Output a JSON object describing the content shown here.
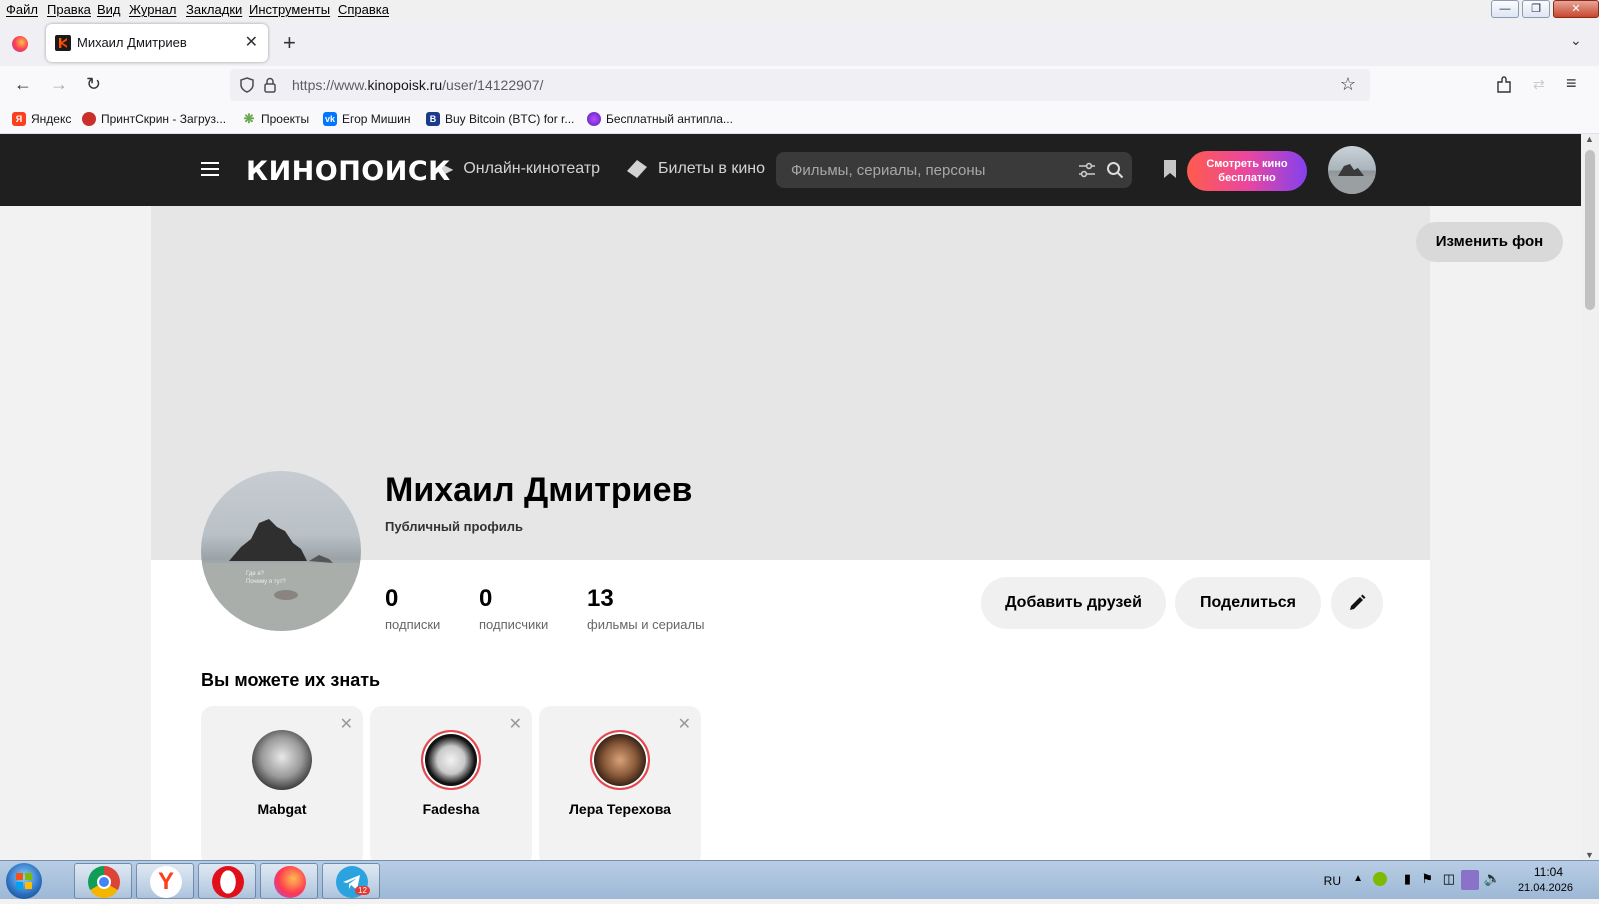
{
  "menubar": [
    "Файл",
    "Правка",
    "Вид",
    "Журнал",
    "Закладки",
    "Инструменты",
    "Справка"
  ],
  "tab": {
    "title": "Михаил Дмитриев"
  },
  "address": {
    "prefix": "https://www.",
    "domain": "kinopoisk.ru",
    "path": "/user/14122907/"
  },
  "bookmarks": [
    "Яндекс",
    "ПринтСкрин - Загруз...",
    "Проекты",
    "Егор Мишин",
    "Buy Bitcoin (BTC) for r...",
    "Бесплатный антипла..."
  ],
  "site": {
    "logo": "КИНОПОИСК",
    "nav_online": "Онлайн-кинотеатр",
    "nav_tickets": "Билеты в кино",
    "search_placeholder": "Фильмы, сериалы, персоны",
    "cta": "Смотреть кино бесплатно",
    "accent": "#ff5c4d"
  },
  "profile": {
    "change_bg": "Изменить фон",
    "name": "Михаил Дмитриев",
    "visibility": "Публичный профиль",
    "stats": [
      {
        "value": "0",
        "label": "подписки"
      },
      {
        "value": "0",
        "label": "подписчики"
      },
      {
        "value": "13",
        "label": "фильмы и сериалы"
      }
    ],
    "add_friends": "Добавить друзей",
    "share": "Поделиться",
    "avatar_caption": [
      "Где я?",
      "Почему я тут?"
    ]
  },
  "suggest": {
    "title": "Вы можете их знать",
    "people": [
      {
        "name": "Mabgat"
      },
      {
        "name": "Fadesha"
      },
      {
        "name": "Лера Терехова"
      }
    ]
  },
  "taskbar": {
    "telegram_badge": "12",
    "lang": "RU",
    "time": "11:04",
    "date": "21.04.2026"
  }
}
